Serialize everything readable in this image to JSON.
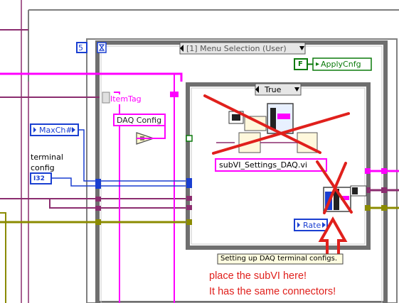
{
  "loop": {
    "count": "5",
    "case_selector_label": "[1] Menu Selection (User)"
  },
  "inner_case": {
    "selector_label": "True"
  },
  "constants": {
    "item_tag": "ItemTag",
    "daq_config": "DAQ Config",
    "apply_cfg_bool": "F",
    "apply_cfg": "ApplyCnfg",
    "max_ch": "MaxCh#",
    "terminal_config_label": "terminal config",
    "terminal_config_type": "I32",
    "rate": "Rate",
    "subvi_name": "subVI_Settings_DAQ.vi",
    "caption": "Setting up DAQ terminal configs."
  },
  "annotation": {
    "line1": "place the subVI here!",
    "line2": "It has the same connectors!"
  },
  "colors": {
    "string_wire": "#ff00ff",
    "cluster_wire": "#8b2d6f",
    "numeric_wire": "#1a3fd1",
    "error_wire": "#8b8b00",
    "boolean_wire": "#0b7a0b",
    "frame": "#7a7a7a",
    "annotation_red": "#e0201c"
  }
}
